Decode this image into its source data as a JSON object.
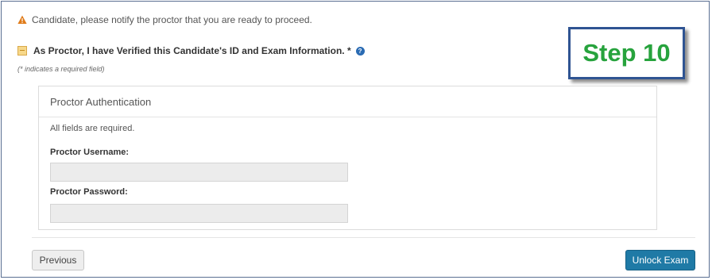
{
  "notice": {
    "icon": "warning-icon",
    "text": "Candidate, please notify the proctor that you are ready to proceed."
  },
  "verify": {
    "label": "As Proctor, I have Verified this Candidate's ID and Exam Information. *",
    "help_icon": "?"
  },
  "required_note": "(* indicates a required field)",
  "step_badge": {
    "text": "Step 10",
    "text_color": "#27a33d",
    "border_color": "#2f5492"
  },
  "panel": {
    "title": "Proctor Authentication",
    "all_required": "All fields are required.",
    "username_label": "Proctor Username:",
    "username_value": "",
    "password_label": "Proctor Password:",
    "password_value": ""
  },
  "buttons": {
    "previous": "Previous",
    "unlock": "Unlock Exam",
    "unlock_color": "#1f7aa6"
  }
}
